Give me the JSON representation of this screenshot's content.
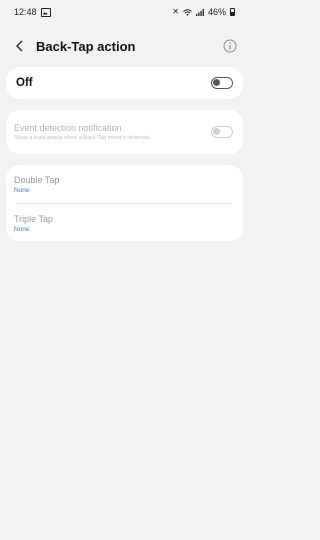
{
  "status_bar": {
    "time": "12:48",
    "battery": "46%",
    "icons": [
      "photo-icon",
      "mute-icon",
      "wifi-icon",
      "signal-icon",
      "battery-icon"
    ]
  },
  "app_bar": {
    "title": "Back-Tap action",
    "back_icon": "back-arrow-icon",
    "info_icon": "info-icon"
  },
  "master_switch": {
    "label": "Off",
    "state": "off"
  },
  "event_notification": {
    "title": "Event detection notification",
    "subtitle": "Show a toast popup when a Back-Tap event is detected.",
    "state": "off",
    "enabled": false
  },
  "taps": [
    {
      "title": "Double Tap",
      "value": "None"
    },
    {
      "title": "Triple Tap",
      "value": "None"
    }
  ],
  "colors": {
    "background": "#f2f2f2",
    "card": "#ffffff",
    "accent_value": "#3e7cc4",
    "disabled_text": "#b3b3b3"
  }
}
